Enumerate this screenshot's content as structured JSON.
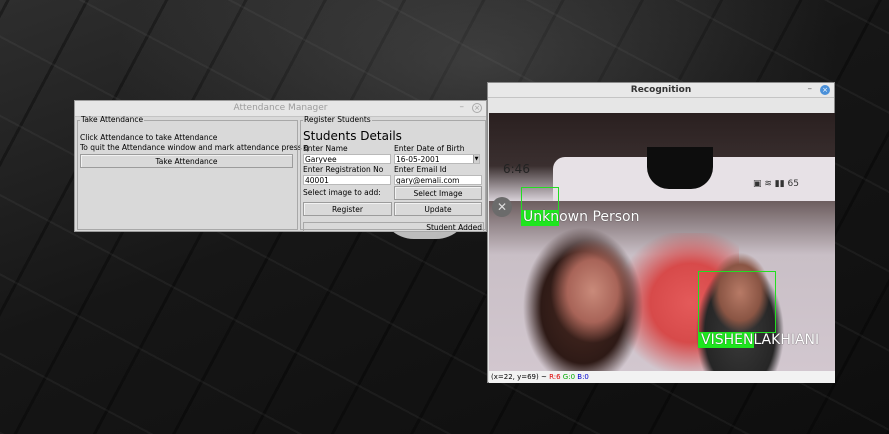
{
  "attendance_window": {
    "title": "Attendance Manager",
    "take_attendance": {
      "legend": "Take Attendance",
      "line1": "Click Attendance to take Attendance",
      "line2": "To quit the Attendance window and mark attendance press q",
      "button": "Take Attendance"
    },
    "register": {
      "legend": "Register Students",
      "heading": "Students Details",
      "name_label": "Enter Name",
      "name_value": "Garyvee",
      "dob_label": "Enter Date of Birth",
      "dob_value": "16-05-2001",
      "reg_label": "Enter Registration No",
      "reg_value": "40001",
      "email_label": "Enter Email Id",
      "email_value": "gary@emali.com",
      "image_label": "Select image to add:",
      "select_image_button": "Select Image",
      "register_button": "Register",
      "update_button": "Update",
      "status": "Student Added"
    }
  },
  "recognition_window": {
    "title": "Recognition",
    "phone_clock": "6:46",
    "phone_signal": "65",
    "label_unknown": "Unknown Person",
    "label_known": "VISHENLAKHIANI",
    "status_coords": "(x=22, y=69) ~",
    "status_r": "R:6",
    "status_g": "G:0",
    "status_b": "B:0"
  }
}
